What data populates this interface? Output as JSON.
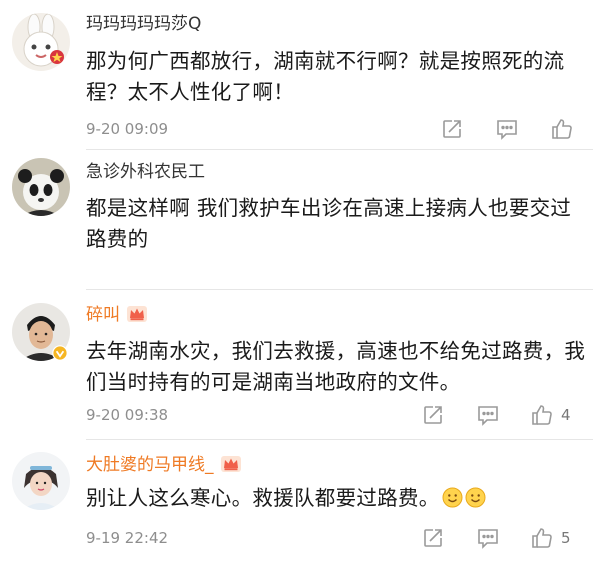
{
  "comments": [
    {
      "username": "玛玛玛玛玛莎Q",
      "text": "那为何广西都放行，湖南就不行啊？就是按照死的流程？太不人性化了啊！",
      "time": "9-20 09:09",
      "like_count": ""
    },
    {
      "username": "急诊外科农民工",
      "text": "都是这样啊 我们救护车出诊在高速上接病人也要交过路费的"
    },
    {
      "username": "碎叫",
      "text": "去年湖南水灾，我们去救援，高速也不给免过路费，我们当时持有的可是湖南当地政府的文件。",
      "time": "9-20 09:38",
      "like_count": "4"
    },
    {
      "username": "大肚婆的马甲线_",
      "text": "别让人这么寒心。救援队都要过路费。",
      "time": "9-19 22:42",
      "like_count": "5"
    }
  ],
  "icons": {
    "share": "share-icon",
    "comment": "comment-icon",
    "like": "thumbs-up-icon",
    "crown": "vip-crown-icon",
    "verified": "verified-badge-icon",
    "smile": "smile-emoji-icon"
  },
  "colors": {
    "vip_name": "#ef7a24",
    "plain_name": "#333333",
    "meta": "#8e8e8e",
    "icon": "#9a9a9a"
  }
}
